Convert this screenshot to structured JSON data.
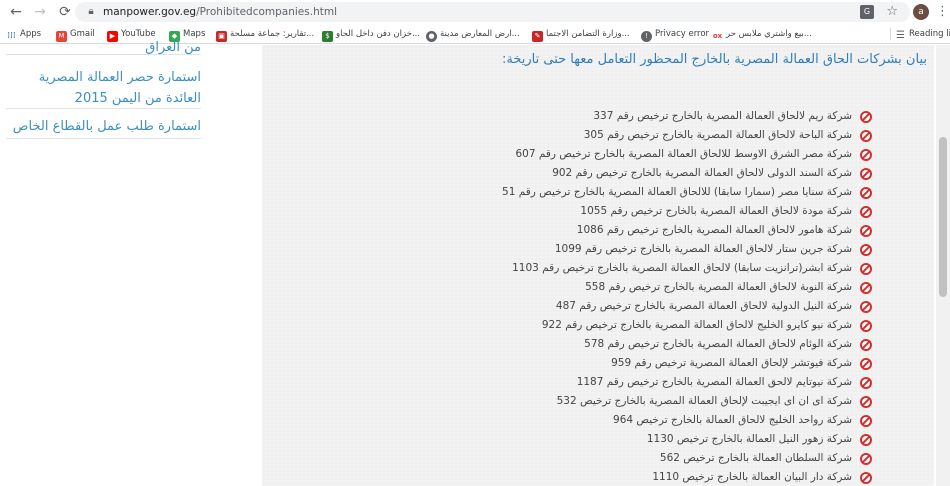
{
  "browser": {
    "url_host": "manpower.gov.eg",
    "url_path": "/Prohibitedcompanies.html",
    "avatar_letter": "a"
  },
  "bookmarks": [
    {
      "label": "Apps",
      "icon": "apps-icon"
    },
    {
      "label": "Gmail",
      "icon": "gmail-icon"
    },
    {
      "label": "YouTube",
      "icon": "youtube-icon"
    },
    {
      "label": "Maps",
      "icon": "maps-icon"
    },
    {
      "label": "تقارير: جماعة مسلحة...",
      "icon": "news-icon"
    },
    {
      "label": "خزان دفن داخل الحاو...",
      "icon": "site-icon"
    },
    {
      "label": "ارض المعارض مدينة...",
      "icon": "globe-icon"
    },
    {
      "label": "وزارة التضامن الاجتما...",
      "icon": "ministry-icon"
    },
    {
      "label": "Privacy error",
      "icon": "error-icon"
    },
    {
      "label": "بيع واشتري ملابس حر...",
      "icon": "olx-icon"
    },
    {
      "label": "Reading list",
      "icon": "reading-list-icon"
    }
  ],
  "sidebar": {
    "links": [
      "من العراق",
      "استمارة حصر العمالة المصرية العائدة من اليمن 2015",
      "استمارة طلب عمل بالقطاع الخاص"
    ]
  },
  "content": {
    "title": "بيان بشركات الحاق العمالة المصرية بالخارج المحظور التعامل معها حتى تاريخة:",
    "companies": [
      "شركة ريم لالحاق العمالة المصرية بالخارج ترخيص رقم 337",
      "شركة الباحة لالحاق العمالة المصرية بالخارج ترخيص رقم 305",
      "شركة مصر الشرق الاوسط للالحاق العمالة المصرية بالخارج ترخيص رقم 607",
      "شركة السند الدولى لالحاق العمالة المصرية بالخارج ترخيص رقم 902",
      "شركة سنايا مصر (سمارا سابقا) للالحاق العمالة المصرية بالخارج ترخيص رقم 51",
      "شركة مودة لالحاق العمالة المصرية بالخارج ترخيص رقم 1055",
      "شركة هامور لالحاق العمالة المصرية بالخارج ترخيص رقم 1086",
      "شركة جرين ستار لالحاق العمالة المصرية بالخارج ترخيص رقم 1099",
      "شركة ابشر(ترانزيت سابقا) لالحاق العمالة المصرية بالخارج ترخيص رقم 1103",
      "شركة النوبة لالحاق العمالة المصرية بالخارج ترخيص رقم 558",
      "شركة النيل الدولية لالحاق العمالة المصرية بالخارج ترخيص رقم 487",
      "شركة نيو كايرو الخليج لالحاق العمالة المصرية بالخارج ترخيص رقم 922",
      "شركة الوئام لالحاق العمالة المصرية بالخارج ترخيص رقم 578",
      "شركة فيوتشر لإلحاق العمالة المصرية ترخيص رقم 959",
      "شركة نيوتايم لالحق العمالة المصرية بالخارج ترخيص رقم 1187",
      "شركة اى ان اى ايجيبت لإلحاق العمالة المصرية بالخارج ترخيص 532",
      "شركة رواحد الخليج لالحاق العمالة بالخارج ترخيص 964",
      "شركة زهور النيل العمالة بالخارج ترخيص 1130",
      "شركة السلطان العمالة بالخارج ترخيص 562",
      "شركة دار البيان العمالة بالخارج ترخيص 1110"
    ]
  },
  "colors": {
    "link": "#3a8fc4",
    "title": "#2f7dbb",
    "ban": "#d32f2f",
    "content_bg": "#f2f2f2"
  }
}
